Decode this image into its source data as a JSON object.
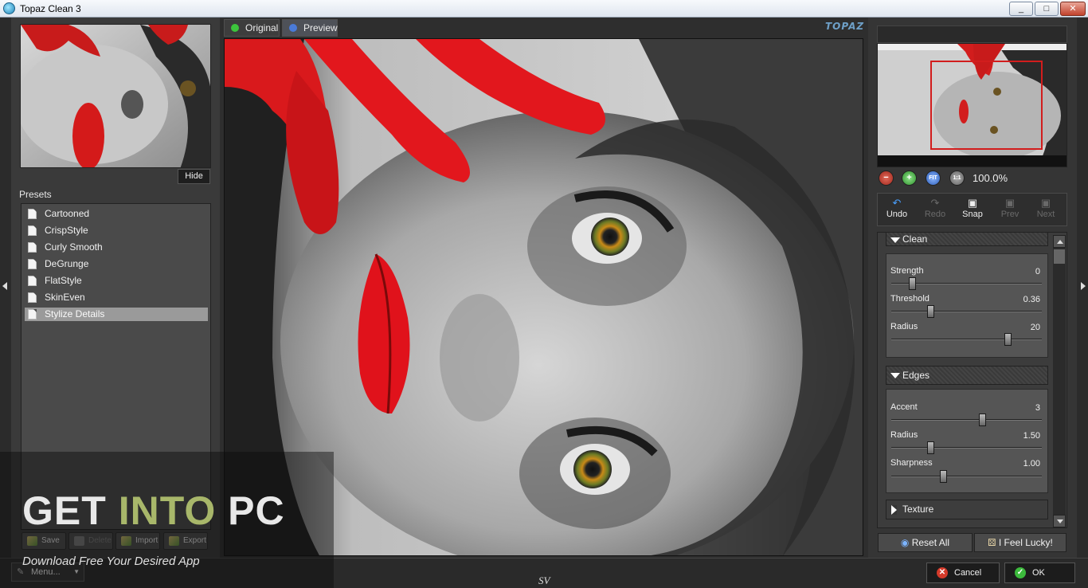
{
  "window": {
    "title": "Topaz Clean 3",
    "controls": [
      "_",
      "□",
      "✕"
    ]
  },
  "left_panel": {
    "hide_label": "Hide",
    "presets_label": "Presets",
    "presets": [
      "Cartooned",
      "CrispStyle",
      "Curly Smooth",
      "DeGrunge",
      "FlatStyle",
      "SkinEven",
      "Stylize Details"
    ],
    "selected_preset": "Stylize Details",
    "buttons": {
      "save": "Save",
      "delete": "Delete",
      "import": "Import",
      "export": "Export"
    },
    "menu_label": "Menu..."
  },
  "view_tabs": {
    "original": "Original",
    "preview": "Preview",
    "active": "Preview"
  },
  "logo_text": "TOPAZ",
  "navigator": {
    "zoom_level": "100.0%",
    "zoom_fit_label": "FIT",
    "zoom_actual_label": "1:1"
  },
  "toolbar": {
    "undo": "Undo",
    "redo": "Redo",
    "snap": "Snap",
    "prev": "Prev",
    "next": "Next"
  },
  "sections": {
    "clean": {
      "label": "Clean",
      "expanded": true,
      "sliders": [
        {
          "label": "Strength",
          "value": "0",
          "level": 0.12
        },
        {
          "label": "Threshold",
          "value": "0.36",
          "level": 0.25
        },
        {
          "label": "Radius",
          "value": "20",
          "level": 0.79
        }
      ]
    },
    "edges": {
      "label": "Edges",
      "expanded": true,
      "sliders": [
        {
          "label": "Accent",
          "value": "3",
          "level": 0.61
        },
        {
          "label": "Radius",
          "value": "1.50",
          "level": 0.25
        },
        {
          "label": "Sharpness",
          "value": "1.00",
          "level": 0.34
        }
      ]
    },
    "texture": {
      "label": "Texture",
      "expanded": false
    }
  },
  "actions": {
    "reset_all": "Reset All",
    "feel_lucky": "I Feel Lucky!",
    "cancel": "Cancel",
    "ok": "OK"
  },
  "footer_text": "SV",
  "watermark": {
    "title_a": "GET ",
    "title_b": "INTO",
    "title_c": " PC",
    "subtitle": "Download Free Your Desired App"
  },
  "colors": {
    "accent_red": "#d21d1d",
    "ok_green": "#3cba3c",
    "cancel_red": "#d43a2a",
    "watermark_accent": "#a8b76a"
  }
}
